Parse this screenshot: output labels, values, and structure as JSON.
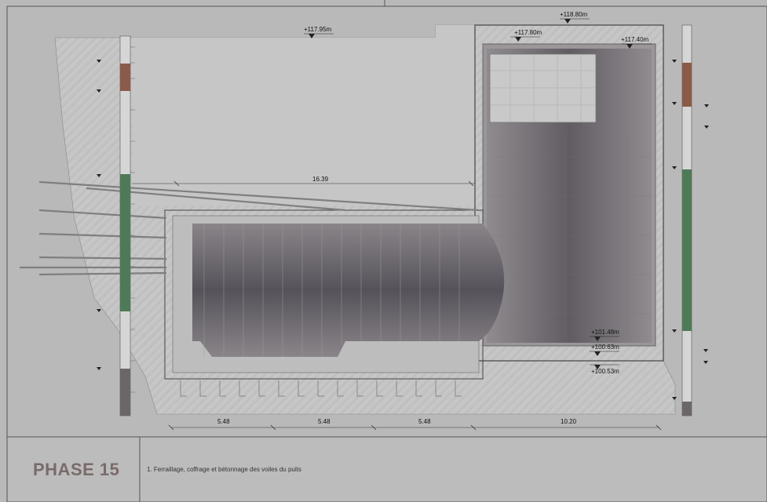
{
  "drawing": {
    "elevations": {
      "ground_left": "+117.95m",
      "slab_top": "+117.80m",
      "top_right": "+118.80m",
      "right_level": "+117.40m",
      "bottom_1": "+101.48m",
      "bottom_2": "+100.63m",
      "bottom_3": "+100.53m"
    },
    "dimensions": {
      "span_top": "16.39",
      "d1": "5.48",
      "d2": "5.48",
      "d3": "5.48",
      "d4": "10.20"
    },
    "colors": {
      "background": "#b9b9b9",
      "hatch_fill": "#c8c8c8",
      "shaft": "#6e6a6d",
      "brown_layer": "#8b5a4a",
      "green_layer": "#4f7a57",
      "dark_layer": "#6a666a"
    }
  },
  "title_block": {
    "phase": "PHASE 15",
    "note": "1. Ferraillage, coffrage et bétonnage des voiles du puits"
  }
}
